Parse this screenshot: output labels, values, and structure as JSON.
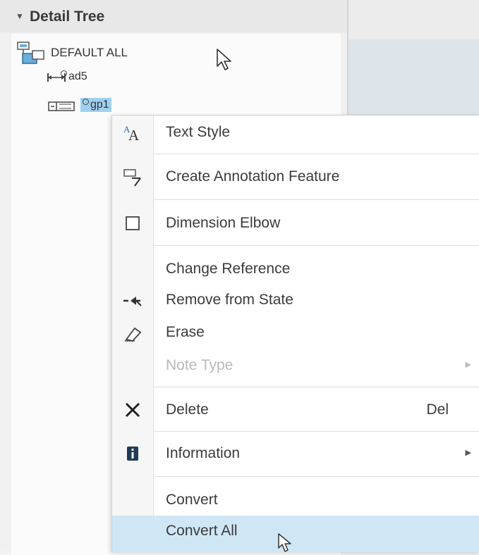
{
  "panel": {
    "title": "Detail Tree"
  },
  "tree": {
    "root_label": "DEFAULT ALL",
    "items": [
      {
        "label": "ad5"
      },
      {
        "label": "gp1"
      }
    ]
  },
  "menu": {
    "items": [
      {
        "label": "Text Style",
        "icon": "text-style-icon"
      },
      {
        "label": "Create Annotation Feature",
        "icon": "annotation-feature-icon"
      },
      {
        "label": "Dimension Elbow",
        "icon": "checkbox-icon"
      },
      {
        "label": "Change Reference",
        "icon": ""
      },
      {
        "label": "Remove from State",
        "icon": "remove-arrow-icon"
      },
      {
        "label": "Erase",
        "icon": "eraser-icon"
      },
      {
        "label": "Note Type",
        "icon": "",
        "disabled": true,
        "submenu": true
      },
      {
        "label": "Delete",
        "icon": "delete-x-icon",
        "shortcut": "Del"
      },
      {
        "label": "Information",
        "icon": "info-icon",
        "submenu": true
      },
      {
        "label": "Convert",
        "icon": ""
      },
      {
        "label": "Convert All",
        "icon": "",
        "highlighted": true
      }
    ]
  },
  "colors": {
    "highlight": "#cfe6f5",
    "selection": "#9fd0f0"
  }
}
